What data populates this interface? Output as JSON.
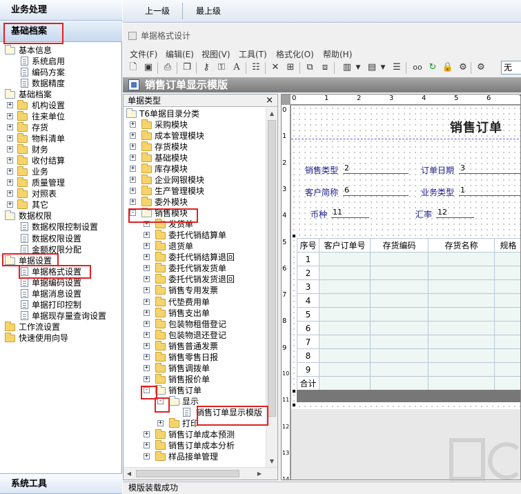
{
  "left_nav": {
    "header_business": "业务处理",
    "header_base": "基础档案",
    "footer": "系统工具",
    "tree": [
      {
        "label": "基本信息",
        "level": 0,
        "kind": "folder",
        "exp": "-"
      },
      {
        "label": "系统启用",
        "level": 1,
        "kind": "doc"
      },
      {
        "label": "编码方案",
        "level": 1,
        "kind": "doc"
      },
      {
        "label": "数据精度",
        "level": 1,
        "kind": "doc"
      },
      {
        "label": "基础档案",
        "level": 0,
        "kind": "folder",
        "exp": "-"
      },
      {
        "label": "机构设置",
        "level": 1,
        "kind": "folder",
        "exp": "+"
      },
      {
        "label": "往来单位",
        "level": 1,
        "kind": "folder",
        "exp": "+"
      },
      {
        "label": "存货",
        "level": 1,
        "kind": "folder",
        "exp": "+"
      },
      {
        "label": "物料清单",
        "level": 1,
        "kind": "folder",
        "exp": "+"
      },
      {
        "label": "财务",
        "level": 1,
        "kind": "folder",
        "exp": "+"
      },
      {
        "label": "收付结算",
        "level": 1,
        "kind": "folder",
        "exp": "+"
      },
      {
        "label": "业务",
        "level": 1,
        "kind": "folder",
        "exp": "+"
      },
      {
        "label": "质量管理",
        "level": 1,
        "kind": "folder",
        "exp": "+"
      },
      {
        "label": "对照表",
        "level": 1,
        "kind": "folder",
        "exp": "+"
      },
      {
        "label": "其它",
        "level": 1,
        "kind": "folder",
        "exp": "+"
      },
      {
        "label": "数据权限",
        "level": 0,
        "kind": "folder",
        "exp": "-"
      },
      {
        "label": "数据权限控制设置",
        "level": 1,
        "kind": "doc"
      },
      {
        "label": "数据权限设置",
        "level": 1,
        "kind": "doc"
      },
      {
        "label": "金额权限分配",
        "level": 1,
        "kind": "doc"
      },
      {
        "label": "单据设置",
        "level": 0,
        "kind": "folder",
        "exp": "-"
      },
      {
        "label": "单据格式设置",
        "level": 1,
        "kind": "doc"
      },
      {
        "label": "单据编码设置",
        "level": 1,
        "kind": "doc"
      },
      {
        "label": "单据消息设置",
        "level": 1,
        "kind": "doc"
      },
      {
        "label": "单据打印控制",
        "level": 1,
        "kind": "doc"
      },
      {
        "label": "单据现存量查询设置",
        "level": 1,
        "kind": "doc"
      },
      {
        "label": "工作流设置",
        "level": 0,
        "kind": "folder"
      },
      {
        "label": "快速使用向导",
        "level": 0,
        "kind": "folder"
      }
    ]
  },
  "top_toolbar": {
    "up_one": "上一级",
    "top_level": "最上级"
  },
  "window": {
    "title": "单据格式设计",
    "menus": [
      "文件(F)",
      "编辑(E)",
      "视图(V)",
      "工具(T)",
      "格式化(O)",
      "帮助(H)"
    ],
    "wu_value": "无",
    "doc_title": "销售订单显示模版",
    "status": "模版装载成功"
  },
  "category_pane": {
    "header": "单据类型",
    "close": "×",
    "tree": [
      {
        "label": "T6单据目录分类",
        "level": 0,
        "kind": "root"
      },
      {
        "label": "采购模块",
        "level": 1,
        "kind": "folder",
        "exp": "+"
      },
      {
        "label": "成本管理模块",
        "level": 1,
        "kind": "folder",
        "exp": "+"
      },
      {
        "label": "存货模块",
        "level": 1,
        "kind": "folder",
        "exp": "+"
      },
      {
        "label": "基础模块",
        "level": 1,
        "kind": "folder",
        "exp": "+"
      },
      {
        "label": "库存模块",
        "level": 1,
        "kind": "folder",
        "exp": "+"
      },
      {
        "label": "企业网银模块",
        "level": 1,
        "kind": "folder",
        "exp": "+"
      },
      {
        "label": "生产管理模块",
        "level": 1,
        "kind": "folder",
        "exp": "+"
      },
      {
        "label": "委外模块",
        "level": 1,
        "kind": "folder",
        "exp": "+"
      },
      {
        "label": "销售模块",
        "level": 1,
        "kind": "folder",
        "exp": "-"
      },
      {
        "label": "发货单",
        "level": 2,
        "kind": "folder",
        "exp": "+"
      },
      {
        "label": "委托代销结算单",
        "level": 2,
        "kind": "folder",
        "exp": "+"
      },
      {
        "label": "退货单",
        "level": 2,
        "kind": "folder",
        "exp": "+"
      },
      {
        "label": "委托代销结算退回",
        "level": 2,
        "kind": "folder",
        "exp": "+"
      },
      {
        "label": "委托代销发货单",
        "level": 2,
        "kind": "folder",
        "exp": "+"
      },
      {
        "label": "委托代销发货退回",
        "level": 2,
        "kind": "folder",
        "exp": "+"
      },
      {
        "label": "销售专用发票",
        "level": 2,
        "kind": "folder",
        "exp": "+"
      },
      {
        "label": "代垫费用单",
        "level": 2,
        "kind": "folder",
        "exp": "+"
      },
      {
        "label": "销售支出单",
        "level": 2,
        "kind": "folder",
        "exp": "+"
      },
      {
        "label": "包装物租借登记",
        "level": 2,
        "kind": "folder",
        "exp": "+"
      },
      {
        "label": "包装物退还登记",
        "level": 2,
        "kind": "folder",
        "exp": "+"
      },
      {
        "label": "销售普通发票",
        "level": 2,
        "kind": "folder",
        "exp": "+"
      },
      {
        "label": "销售零售日报",
        "level": 2,
        "kind": "folder",
        "exp": "+"
      },
      {
        "label": "销售调拨单",
        "level": 2,
        "kind": "folder",
        "exp": "+"
      },
      {
        "label": "销售报价单",
        "level": 2,
        "kind": "folder",
        "exp": "+"
      },
      {
        "label": "销售订单",
        "level": 2,
        "kind": "folder",
        "exp": "-"
      },
      {
        "label": "显示",
        "level": 3,
        "kind": "folder",
        "exp": "-"
      },
      {
        "label": "销售订单显示模版",
        "level": 4,
        "kind": "doc"
      },
      {
        "label": "打印",
        "level": 3,
        "kind": "folder",
        "exp": "+"
      },
      {
        "label": "销售订单成本预测",
        "level": 2,
        "kind": "folder",
        "exp": "+"
      },
      {
        "label": "销售订单成本分析",
        "level": 2,
        "kind": "folder",
        "exp": "+"
      },
      {
        "label": "样品接单管理",
        "level": 2,
        "kind": "folder",
        "exp": "+"
      }
    ]
  },
  "design": {
    "ruler_top": [
      "0",
      "1",
      "2",
      "3",
      "4",
      "5",
      "6",
      "7"
    ],
    "ruler_left": [
      "0",
      "1",
      "2",
      "3",
      "4",
      "5",
      "6",
      "7",
      "8",
      "9",
      "10",
      "11",
      "12",
      "13",
      "14"
    ],
    "form_title": "销售订单",
    "fields": [
      {
        "label": "销售类型",
        "value": "2"
      },
      {
        "label": "订单日期",
        "value": "3"
      },
      {
        "label": "客户简称",
        "value": "6"
      },
      {
        "label": "业务类型",
        "value": "1"
      },
      {
        "label": "币种",
        "value": "11"
      },
      {
        "label": "汇率",
        "value": "12"
      }
    ],
    "columns": [
      "序号",
      "客户订单号",
      "存货编码",
      "存货名称",
      "规格"
    ],
    "rows": [
      "1",
      "2",
      "3",
      "4",
      "5",
      "6",
      "7",
      "8",
      "9"
    ],
    "total_label": "合计"
  }
}
